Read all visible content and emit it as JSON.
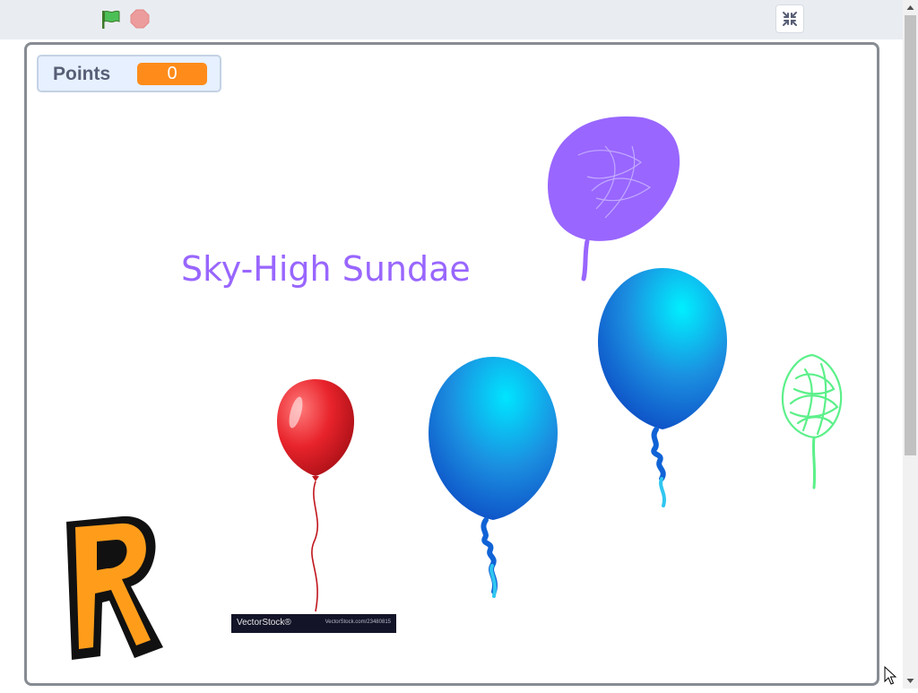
{
  "toolbar": {
    "green_flag_icon": "green-flag-icon",
    "stop_icon": "stop-sign-icon",
    "fullscreen_icon": "exit-fullscreen-icon"
  },
  "stage": {
    "variable_monitor": {
      "label": "Points",
      "value": "0"
    },
    "title": "Sky-High Sundae",
    "sprites": [
      {
        "name": "purple-scribble-balloon",
        "color": "#9966ff"
      },
      {
        "name": "red-balloon",
        "color": "#e8232b"
      },
      {
        "name": "blue-balloon",
        "color": "#1b8fe0"
      },
      {
        "name": "blue-balloon",
        "color": "#1b8fe0"
      },
      {
        "name": "green-scribble-balloon",
        "color": "#5cf08a"
      },
      {
        "name": "letter-r",
        "color": "#ff8c1a"
      }
    ],
    "watermark": {
      "left": "VectorStock®",
      "right": "VectorStock.com/23480815"
    }
  },
  "colors": {
    "accent_orange": "#ff8c1a",
    "title_purple": "#9966ff",
    "stage_border": "#878c93",
    "toolbar_bg": "#e9edf2"
  }
}
